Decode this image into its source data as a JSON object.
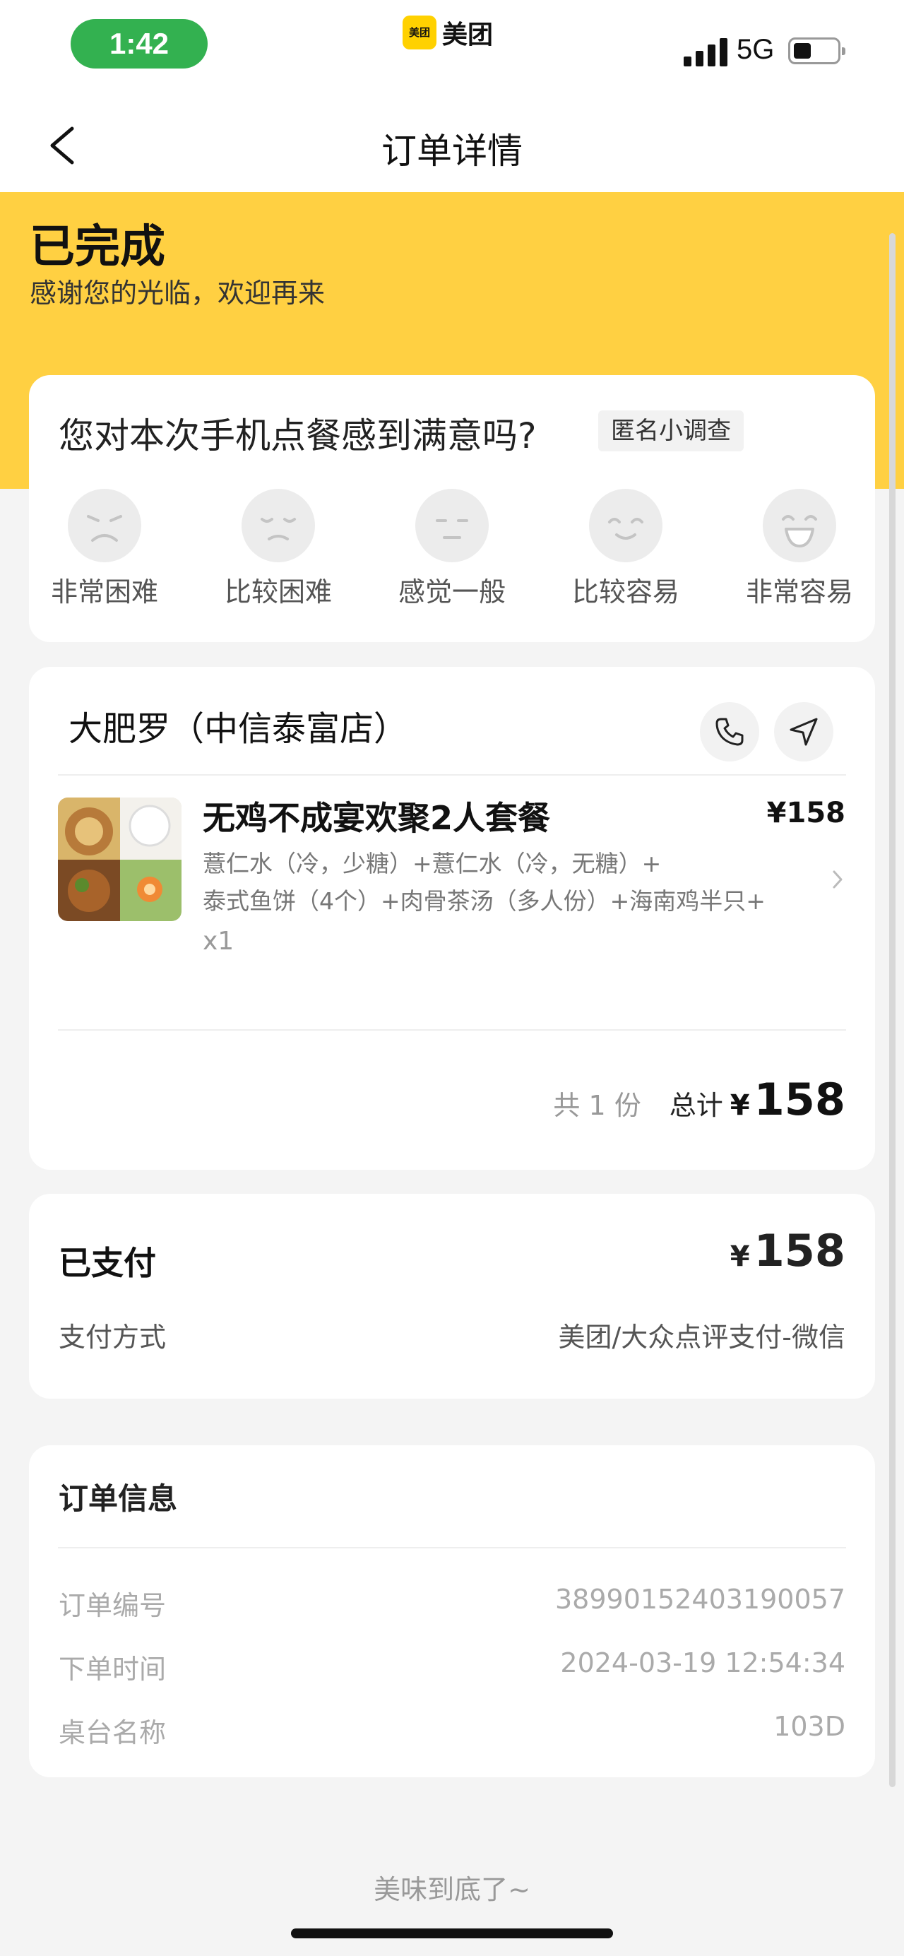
{
  "status_bar": {
    "time": "1:42",
    "app_name": "美团",
    "app_logo_text": "美团",
    "network": "5G"
  },
  "nav": {
    "title": "订单详情"
  },
  "hero": {
    "status": "已完成",
    "message": "感谢您的光临，欢迎再来"
  },
  "survey": {
    "question": "您对本次手机点餐感到满意吗?",
    "tag": "匿名小调查",
    "options": [
      {
        "label": "非常困难",
        "icon": "very-sad-face-icon"
      },
      {
        "label": "比较困难",
        "icon": "sad-face-icon"
      },
      {
        "label": "感觉一般",
        "icon": "neutral-face-icon"
      },
      {
        "label": "比较容易",
        "icon": "smile-face-icon"
      },
      {
        "label": "非常容易",
        "icon": "laugh-face-icon"
      }
    ]
  },
  "order": {
    "store_name": "大肥罗（中信泰富店）",
    "item": {
      "name": "无鸡不成宴欢聚2人套餐",
      "price": "¥158",
      "desc_line1": "薏仁水（冷，少糖）+薏仁水（冷，无糖）+",
      "desc_line2": "泰式鱼饼（4个）+肉骨茶汤（多人份）+海南鸡半只+",
      "qty": "x1"
    },
    "count_text": "共 1 份",
    "total_label": "总计",
    "currency": "¥",
    "total": "158"
  },
  "payment": {
    "status": "已支付",
    "currency": "¥",
    "amount": "158",
    "method_label": "支付方式",
    "method": "美团/大众点评支付-微信"
  },
  "info": {
    "title": "订单信息",
    "rows": [
      {
        "label": "订单编号",
        "value": "38990152403190057"
      },
      {
        "label": "下单时间",
        "value": "2024-03-19 12:54:34"
      },
      {
        "label": "桌台名称",
        "value": "103D"
      }
    ]
  },
  "footer": "美味到底了~",
  "colors": {
    "brand_yellow": "#ffd042",
    "time_pill": "#33b150",
    "background": "#f4f4f4"
  }
}
